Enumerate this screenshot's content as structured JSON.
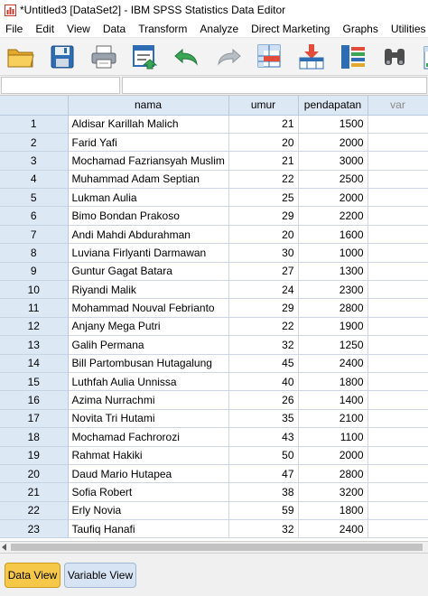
{
  "window": {
    "title": "*Untitled3 [DataSet2] - IBM SPSS Statistics Data Editor"
  },
  "menu": {
    "items": [
      "File",
      "Edit",
      "View",
      "Data",
      "Transform",
      "Analyze",
      "Direct Marketing",
      "Graphs",
      "Utilities"
    ]
  },
  "toolbar": {
    "icons": [
      "open-folder-icon",
      "save-icon",
      "print-icon",
      "recall-dialog-icon",
      "undo-icon",
      "redo-icon",
      "go-to-case-icon",
      "go-to-variable-icon",
      "variables-icon",
      "find-icon",
      "insert-cases-icon"
    ]
  },
  "cell_editor": {
    "ref": "",
    "value": ""
  },
  "grid": {
    "columns": [
      "nama",
      "umur",
      "pendapatan",
      "var"
    ],
    "rows": [
      {
        "n": "1",
        "nama": "Aldisar Karillah Malich",
        "umur": "21",
        "pendapatan": "1500"
      },
      {
        "n": "2",
        "nama": "Farid Yafi",
        "umur": "20",
        "pendapatan": "2000"
      },
      {
        "n": "3",
        "nama": "Mochamad Fazriansyah Muslim",
        "umur": "21",
        "pendapatan": "3000"
      },
      {
        "n": "4",
        "nama": "Muhammad Adam Septian",
        "umur": "22",
        "pendapatan": "2500"
      },
      {
        "n": "5",
        "nama": "Lukman Aulia",
        "umur": "25",
        "pendapatan": "2000"
      },
      {
        "n": "6",
        "nama": "Bimo Bondan Prakoso",
        "umur": "29",
        "pendapatan": "2200"
      },
      {
        "n": "7",
        "nama": "Andi Mahdi Abdurahman",
        "umur": "20",
        "pendapatan": "1600"
      },
      {
        "n": "8",
        "nama": "Luviana Firlyanti Darmawan",
        "umur": "30",
        "pendapatan": "1000"
      },
      {
        "n": "9",
        "nama": "Guntur Gagat Batara",
        "umur": "27",
        "pendapatan": "1300"
      },
      {
        "n": "10",
        "nama": "Riyandi Malik",
        "umur": "24",
        "pendapatan": "2300"
      },
      {
        "n": "11",
        "nama": "Mohammad Nouval Febrianto",
        "umur": "29",
        "pendapatan": "2800"
      },
      {
        "n": "12",
        "nama": "Anjany Mega Putri",
        "umur": "22",
        "pendapatan": "1900"
      },
      {
        "n": "13",
        "nama": "Galih Permana",
        "umur": "32",
        "pendapatan": "1250"
      },
      {
        "n": "14",
        "nama": "Bill Partombusan Hutagalung",
        "umur": "45",
        "pendapatan": "2400"
      },
      {
        "n": "15",
        "nama": "Luthfah Aulia Unnissa",
        "umur": "40",
        "pendapatan": "1800"
      },
      {
        "n": "16",
        "nama": "Azima Nurrachmi",
        "umur": "26",
        "pendapatan": "1400"
      },
      {
        "n": "17",
        "nama": "Novita Tri Hutami",
        "umur": "35",
        "pendapatan": "2100"
      },
      {
        "n": "18",
        "nama": "Mochamad Fachrorozi",
        "umur": "43",
        "pendapatan": "1100"
      },
      {
        "n": "19",
        "nama": "Rahmat Hakiki",
        "umur": "50",
        "pendapatan": "2000"
      },
      {
        "n": "20",
        "nama": "Daud Mario Hutapea",
        "umur": "47",
        "pendapatan": "2800"
      },
      {
        "n": "21",
        "nama": "Sofia Robert",
        "umur": "38",
        "pendapatan": "3200"
      },
      {
        "n": "22",
        "nama": "Erly Novia",
        "umur": "59",
        "pendapatan": "1800"
      },
      {
        "n": "23",
        "nama": "Taufiq Hanafi",
        "umur": "32",
        "pendapatan": "2400"
      }
    ]
  },
  "tabs": {
    "data_view": "Data View",
    "variable_view": "Variable View"
  },
  "colors": {
    "header_bg": "#dde8f5",
    "active_tab": "#f6c84a",
    "inactive_tab": "#d6e4f4",
    "toolbar_bg": "#f3f3f3"
  }
}
